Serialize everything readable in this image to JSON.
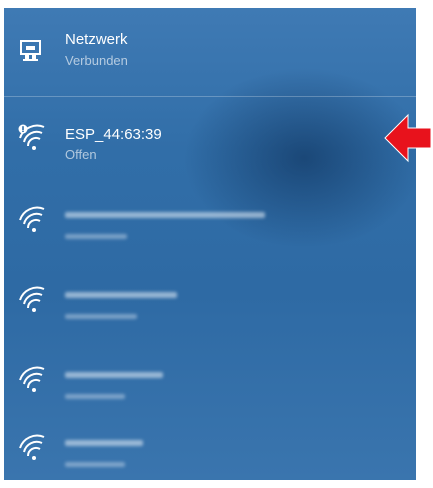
{
  "connected_network": {
    "icon": "ethernet-network-icon",
    "title": "Netzwerk",
    "status": "Verbunden"
  },
  "wifi_networks": [
    {
      "icon": "wifi-secured-warning-icon",
      "ssid": "ESP_44:63:39",
      "status": "Offen"
    },
    {
      "icon": "wifi-icon",
      "redacted": true
    },
    {
      "icon": "wifi-icon",
      "redacted": true
    },
    {
      "icon": "wifi-icon",
      "redacted": true
    },
    {
      "icon": "wifi-icon",
      "redacted": true
    }
  ],
  "annotation": {
    "icon": "red-arrow-left-icon",
    "color": "#e8121c"
  }
}
